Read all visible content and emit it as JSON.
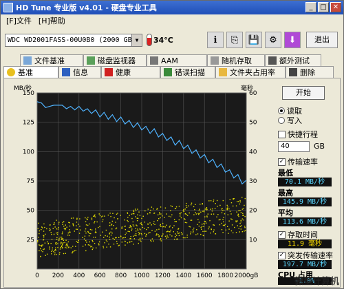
{
  "window": {
    "title": "HD Tune 专业版 v4.01 - 硬盘专业工具",
    "minimize": "_",
    "maximize": "□",
    "close": "✕"
  },
  "menu": [
    {
      "label": "[F]文件"
    },
    {
      "label": "[H]帮助"
    }
  ],
  "toolbar": {
    "drive": "WDC WD2001FASS-00U0B0 (2000 GB)",
    "temperature": "34°C",
    "icons": [
      "info-icon",
      "copy-icon",
      "save-icon",
      "settings-icon",
      "download-icon"
    ],
    "exit_label": "退出"
  },
  "tabs_top": [
    {
      "label": "文件基准",
      "icon": "file-icon"
    },
    {
      "label": "磁盘监视器",
      "icon": "monitor-icon"
    },
    {
      "label": "AAM",
      "icon": "speaker-icon"
    },
    {
      "label": "随机存取",
      "icon": "random-icon"
    },
    {
      "label": "额外测试",
      "icon": "extra-icon"
    }
  ],
  "tabs_bottom": [
    {
      "label": "基准",
      "icon": "benchmark-icon",
      "active": true
    },
    {
      "label": "信息",
      "icon": "info-icon"
    },
    {
      "label": "健康",
      "icon": "health-icon"
    },
    {
      "label": "错误扫描",
      "icon": "scan-icon"
    },
    {
      "label": "文件夹占用率",
      "icon": "folder-icon"
    },
    {
      "label": "删除",
      "icon": "delete-icon"
    }
  ],
  "panel": {
    "start_label": "开始",
    "read_label": "读取",
    "write_label": "写入",
    "short_stroke_label": "快捷行程",
    "short_stroke_value": "40",
    "short_stroke_unit": "GB",
    "transfer_rate_label": "传输速率",
    "min_label": "最低",
    "min_value": "70.1 MB/秒",
    "max_label": "最高",
    "max_value": "145.9 MB/秒",
    "avg_label": "平均",
    "avg_value": "113.6 MB/秒",
    "access_time_label": "存取时间",
    "access_time_value": "11.9 毫秒",
    "burst_label": "突发传输速率",
    "burst_value": "197.7 MB/秒",
    "cpu_label": "CPU 占用",
    "cpu_value": "-1.0%"
  },
  "watermark": "微型计算机",
  "chart_data": {
    "type": "line",
    "ylabel": "MB/秒",
    "y2label": "毫秒",
    "xlim": [
      0,
      2000
    ],
    "ylim": [
      0,
      150
    ],
    "y2lim": [
      0,
      60
    ],
    "x_ticks": [
      "0",
      "200",
      "400",
      "600",
      "800",
      "1000",
      "1200",
      "1400",
      "1600",
      "1800",
      "2000gB"
    ],
    "y_ticks": [
      "150",
      "125",
      "100",
      "75",
      "50",
      "25"
    ],
    "y2_ticks": [
      "60",
      "50",
      "40",
      "30",
      "20",
      "10"
    ],
    "grid": true,
    "series": [
      {
        "name": "传输速率",
        "color": "#4fb3ff",
        "x": [
          0,
          40,
          80,
          120,
          160,
          200,
          240,
          280,
          320,
          360,
          400,
          440,
          480,
          520,
          560,
          600,
          640,
          680,
          720,
          760,
          800,
          840,
          880,
          920,
          960,
          1000,
          1040,
          1080,
          1120,
          1160,
          1200,
          1240,
          1280,
          1320,
          1360,
          1400,
          1440,
          1480,
          1520,
          1560,
          1600,
          1640,
          1680,
          1720,
          1760,
          1800,
          1840,
          1880,
          1920,
          1960,
          2000
        ],
        "values": [
          140,
          144,
          135,
          141,
          137,
          142,
          137,
          139,
          136,
          138,
          136,
          137,
          134,
          135,
          133,
          132,
          131,
          130,
          129,
          128,
          127,
          126,
          124,
          123,
          122,
          121,
          119,
          118,
          117,
          115,
          113,
          112,
          110,
          108,
          107,
          105,
          103,
          101,
          99,
          97,
          95,
          93,
          91,
          89,
          87,
          85,
          82,
          80,
          78,
          75,
          73
        ]
      },
      {
        "name": "存取时间",
        "color": "#e6e000",
        "style": "scatter",
        "trend_x": [
          0,
          500,
          1000,
          1500,
          2000
        ],
        "trend_ms": [
          10,
          12.5,
          15,
          17,
          19
        ]
      }
    ]
  }
}
